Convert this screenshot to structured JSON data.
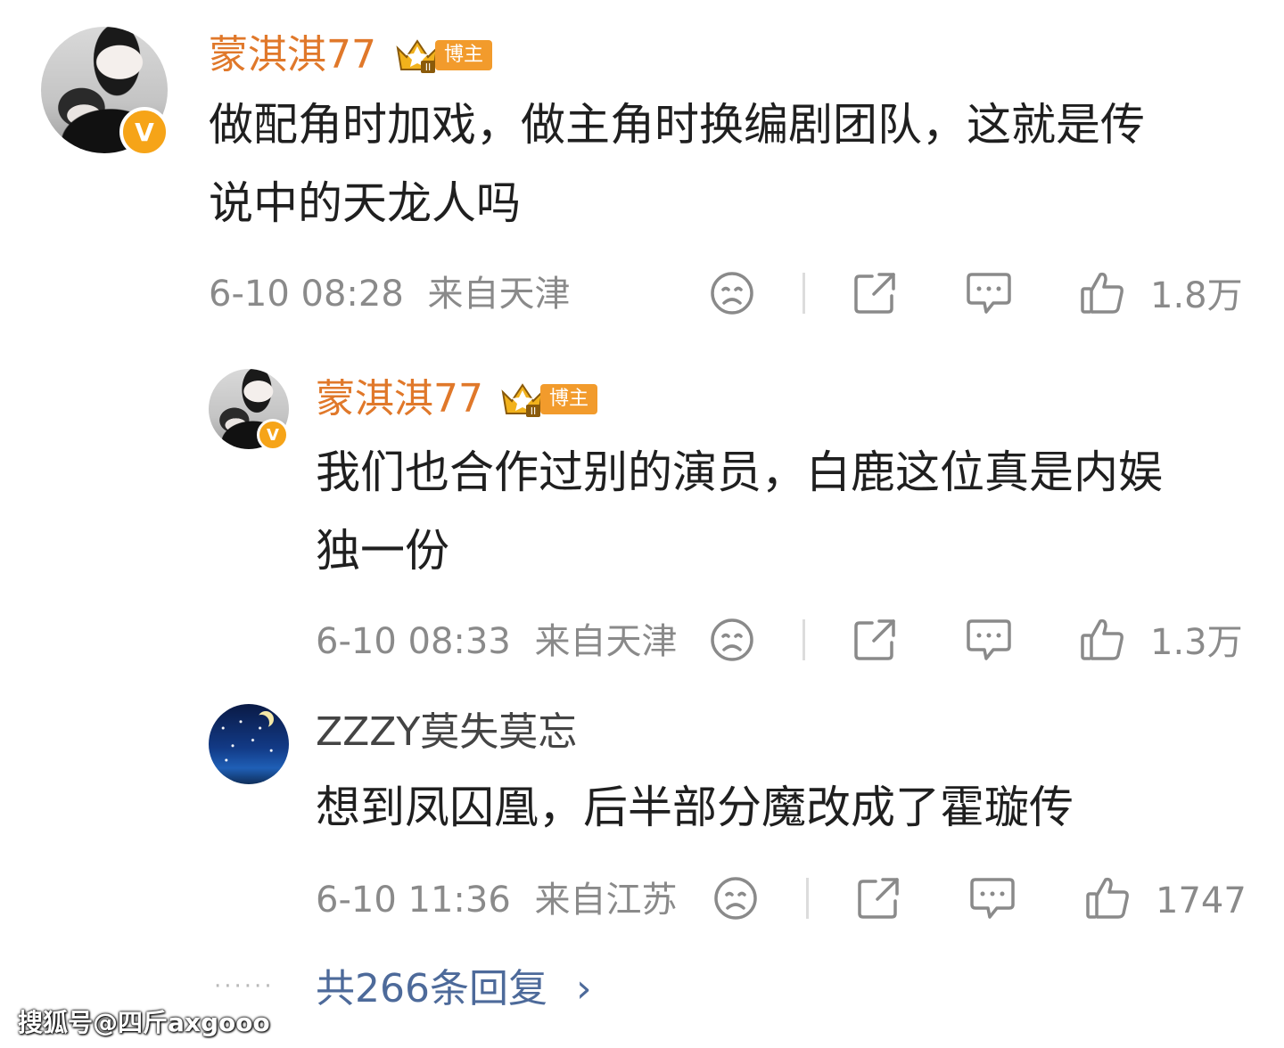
{
  "comments": [
    {
      "username": "蒙淇淇77",
      "badge": "博主",
      "verified": "V",
      "text_line1": "做配角时加戏，做主角时换编剧团队，这就是传",
      "text_line2": "说中的天龙人吗",
      "time": "6-10 08:28",
      "location": "来自天津",
      "likes": "1.8万"
    },
    {
      "username": "蒙淇淇77",
      "badge": "博主",
      "verified": "V",
      "text_line1": "我们也合作过别的演员，白鹿这位真是内娱",
      "text_line2": "独一份",
      "time": "6-10 08:33",
      "location": "来自天津",
      "likes": "1.3万"
    },
    {
      "username": "ZZZY莫失莫忘",
      "text_line1": "想到凤囚凰，后半部分魔改成了霍璇传",
      "time": "6-10 11:36",
      "location": "来自江苏",
      "likes": "1747"
    }
  ],
  "more": {
    "dots": "······",
    "label": "共266条回复",
    "chevron": "›"
  },
  "watermark": "搜狐号@四斤axgooo",
  "icons": {
    "dislike": "sad-face-icon",
    "share": "share-icon",
    "comment": "comment-icon",
    "like": "thumbs-up-icon",
    "crown": "crown-icon"
  },
  "colors": {
    "username": "#e0782a",
    "badge": "#f29b2c",
    "verified": "#f6a418",
    "meta": "#8a8a8a",
    "link": "#4d6a9a"
  }
}
